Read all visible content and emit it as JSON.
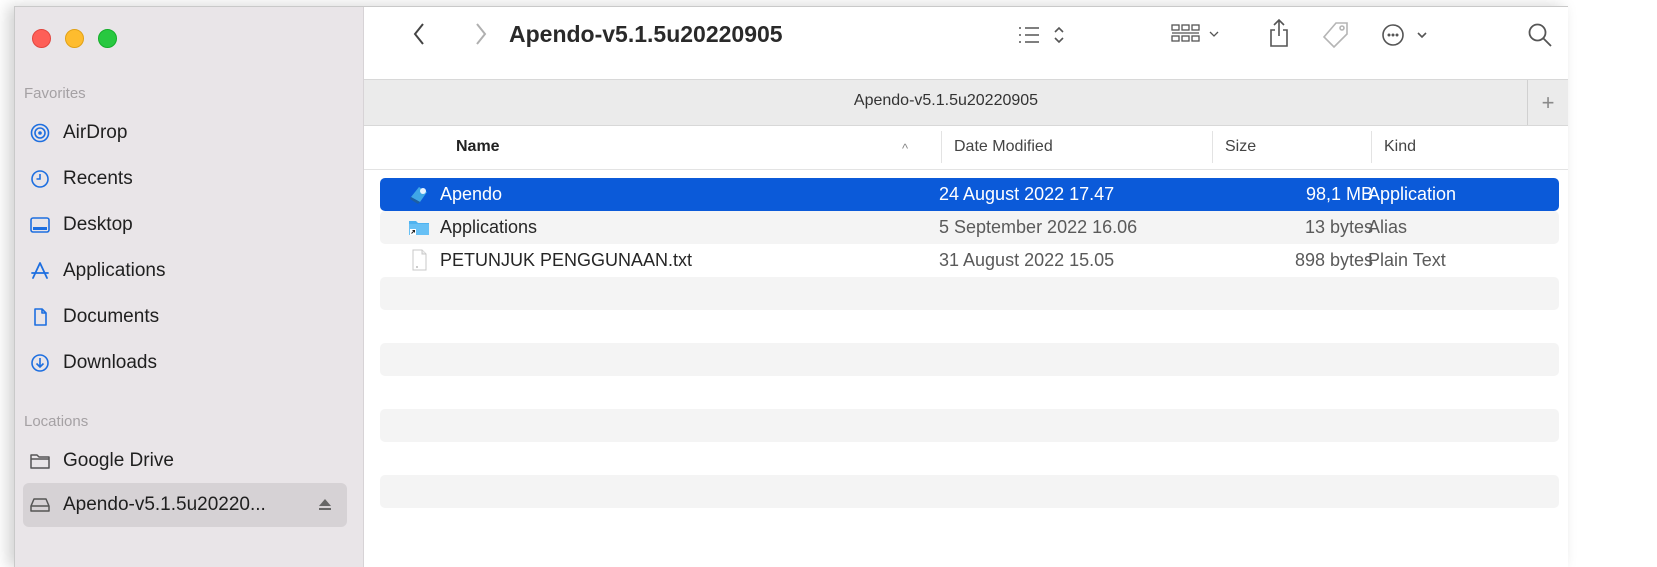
{
  "window": {
    "title": "Apendo-v5.1.5u20220905",
    "tab_title": "Apendo-v5.1.5u20220905",
    "tab_add": "+"
  },
  "sidebar": {
    "favorites_heading": "Favorites",
    "favorites": [
      {
        "label": "AirDrop",
        "icon": "airdrop-icon"
      },
      {
        "label": "Recents",
        "icon": "clock-icon"
      },
      {
        "label": "Desktop",
        "icon": "desktop-icon"
      },
      {
        "label": "Applications",
        "icon": "applications-icon"
      },
      {
        "label": "Documents",
        "icon": "document-icon"
      },
      {
        "label": "Downloads",
        "icon": "download-icon"
      }
    ],
    "locations_heading": "Locations",
    "locations": [
      {
        "label": "Google Drive",
        "icon": "folder-icon"
      },
      {
        "label": "Apendo-v5.1.5u20220...",
        "icon": "drive-icon",
        "selected": true
      }
    ]
  },
  "columns": {
    "name": "Name",
    "date": "Date Modified",
    "size": "Size",
    "kind": "Kind",
    "sort": "^"
  },
  "files": [
    {
      "name": "Apendo",
      "date": "24 August 2022 17.47",
      "size": "98,1 MB",
      "kind": "Application",
      "icon": "app-icon",
      "selected": true
    },
    {
      "name": "Applications",
      "date": "5 September 2022 16.06",
      "size": "13 bytes",
      "kind": "Alias",
      "icon": "alias-folder-icon"
    },
    {
      "name": "PETUNJUK PENGGUNAAN.txt",
      "date": "31 August 2022 15.05",
      "size": "898 bytes",
      "kind": "Plain Text",
      "icon": "text-file-icon"
    }
  ],
  "colors": {
    "selection": "#0b5ad9",
    "sidebar_bg": "#e9e5e8",
    "accent_icon": "#1e6fe0"
  }
}
